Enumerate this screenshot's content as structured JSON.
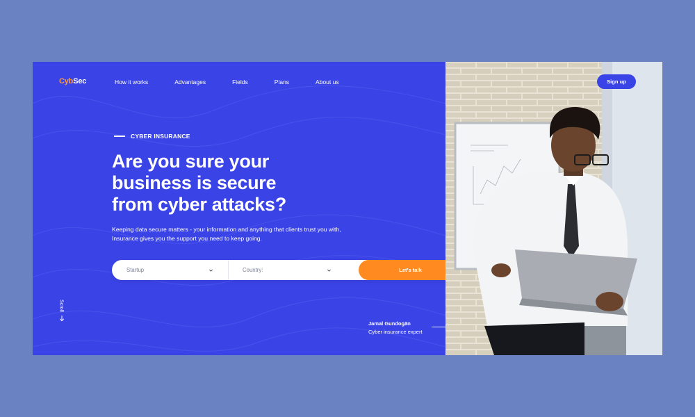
{
  "brand": {
    "part1": "Cyb",
    "part2": "Sec"
  },
  "nav": {
    "items": [
      "How it works",
      "Advantages",
      "Fields",
      "Plans",
      "About us"
    ]
  },
  "header": {
    "signup_label": "Sign up"
  },
  "hero": {
    "eyebrow": "CYBER INSURANCE",
    "headline": [
      "Are you sure your",
      "business is secure",
      "from cyber attacks?"
    ],
    "description": "Keeping data secure matters - your information and anything that clients trust you with, Insurance gives you the support you need to keep going."
  },
  "search": {
    "field1_value": "Startup",
    "field2_value": "Country:",
    "cta_label": "Let's talk"
  },
  "scroll": {
    "label": "Scroll"
  },
  "person": {
    "name": "Jamal Gundogān",
    "role": "Cyber insurance expert"
  },
  "colors": {
    "primary": "#3a43e6",
    "accent": "#ff8a1f",
    "background": "#6a82c2",
    "logo_accent": "#ff9a3c"
  },
  "icons": {
    "dropdown": "chevron-down-icon",
    "scroll": "arrow-down-icon"
  }
}
